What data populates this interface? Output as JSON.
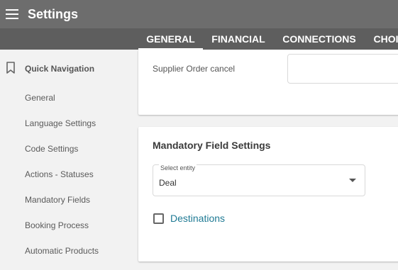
{
  "header": {
    "title": "Settings",
    "menu_icon": "hamburger-menu-icon"
  },
  "tabs": [
    {
      "label": "GENERAL",
      "active": true
    },
    {
      "label": "FINANCIAL",
      "active": false
    },
    {
      "label": "CONNECTIONS",
      "active": false
    },
    {
      "label": "CHOI",
      "active": false
    }
  ],
  "sidebar": {
    "title": "Quick Navigation",
    "icon": "bookmark-icon",
    "items": [
      {
        "label": "General"
      },
      {
        "label": "Language Settings"
      },
      {
        "label": "Code Settings"
      },
      {
        "label": "Actions - Statuses"
      },
      {
        "label": "Mandatory Fields"
      },
      {
        "label": "Booking Process"
      },
      {
        "label": "Automatic Products"
      }
    ]
  },
  "top_card": {
    "field_label": "Supplier Order cancel",
    "field_value": ""
  },
  "mandatory_card": {
    "title": "Mandatory Field Settings",
    "select_label": "Select entity",
    "select_value": "Deal",
    "checkbox_label": "Destinations",
    "checkbox_checked": false
  },
  "colors": {
    "topbar": "#6d6d6d",
    "tabbar": "#5e5e5e",
    "link": "#1f7a94"
  }
}
